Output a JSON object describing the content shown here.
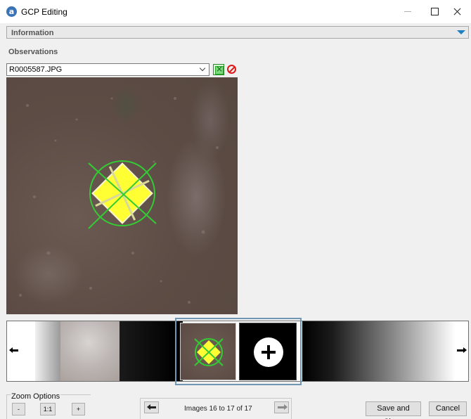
{
  "window": {
    "title": "GCP Editing",
    "icon": "app-logo-icon"
  },
  "information": {
    "label": "Information"
  },
  "observations": {
    "label": "Observations",
    "selected_image": "R0005587.JPG"
  },
  "zoom": {
    "title": "Zoom Options",
    "minus_label": "-",
    "one_to_one_label": "1:1",
    "plus_label": "+"
  },
  "navigation": {
    "status": "Images 16 to 17 of 17"
  },
  "actions": {
    "save_label": "Save and Close",
    "cancel_label": "Cancel"
  },
  "colors": {
    "marker_green": "#33cc33",
    "target_yellow": "#ffff33",
    "selection_frame": "#6f96b2",
    "reject_red": "#dd1a1a",
    "info_toggle": "#1f7fbf"
  }
}
